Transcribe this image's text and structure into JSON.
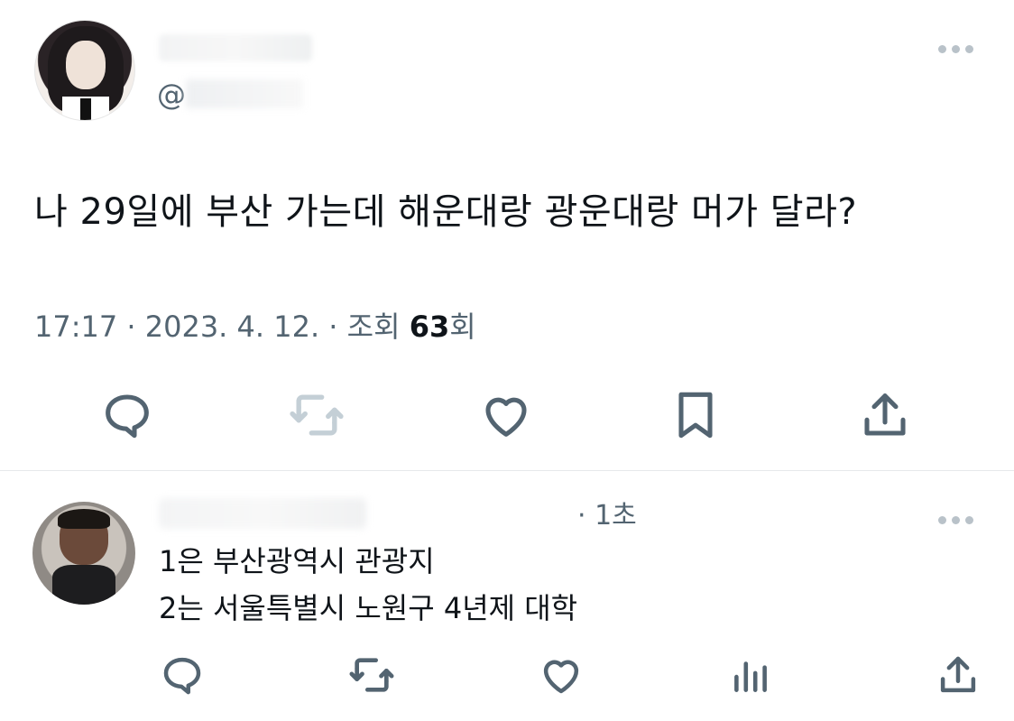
{
  "tweet": {
    "handle_prefix": "@",
    "text": "나 29일에 부산 가는데 해운대랑 광운대랑 머가 달라?",
    "time": "17:17 · 2023. 4. 12. · 조회 ",
    "views": "63",
    "views_suffix": "회",
    "actions": [
      "reply-icon",
      "retweet-icon",
      "like-icon",
      "bookmark-icon",
      "share-icon"
    ]
  },
  "reply": {
    "time": "· 1초",
    "line1": "1은 부산광역시 관광지",
    "line2": "2는 서울특별시 노원구 4년제 대학",
    "actions": [
      "reply-icon",
      "retweet-icon",
      "like-icon",
      "views-icon",
      "share-icon"
    ]
  },
  "colors": {
    "text": "#0f1419",
    "secondary": "#536471",
    "icon": "#536471",
    "icon_disabled": "#c4cfd6",
    "divider": "#e6e9eb"
  }
}
